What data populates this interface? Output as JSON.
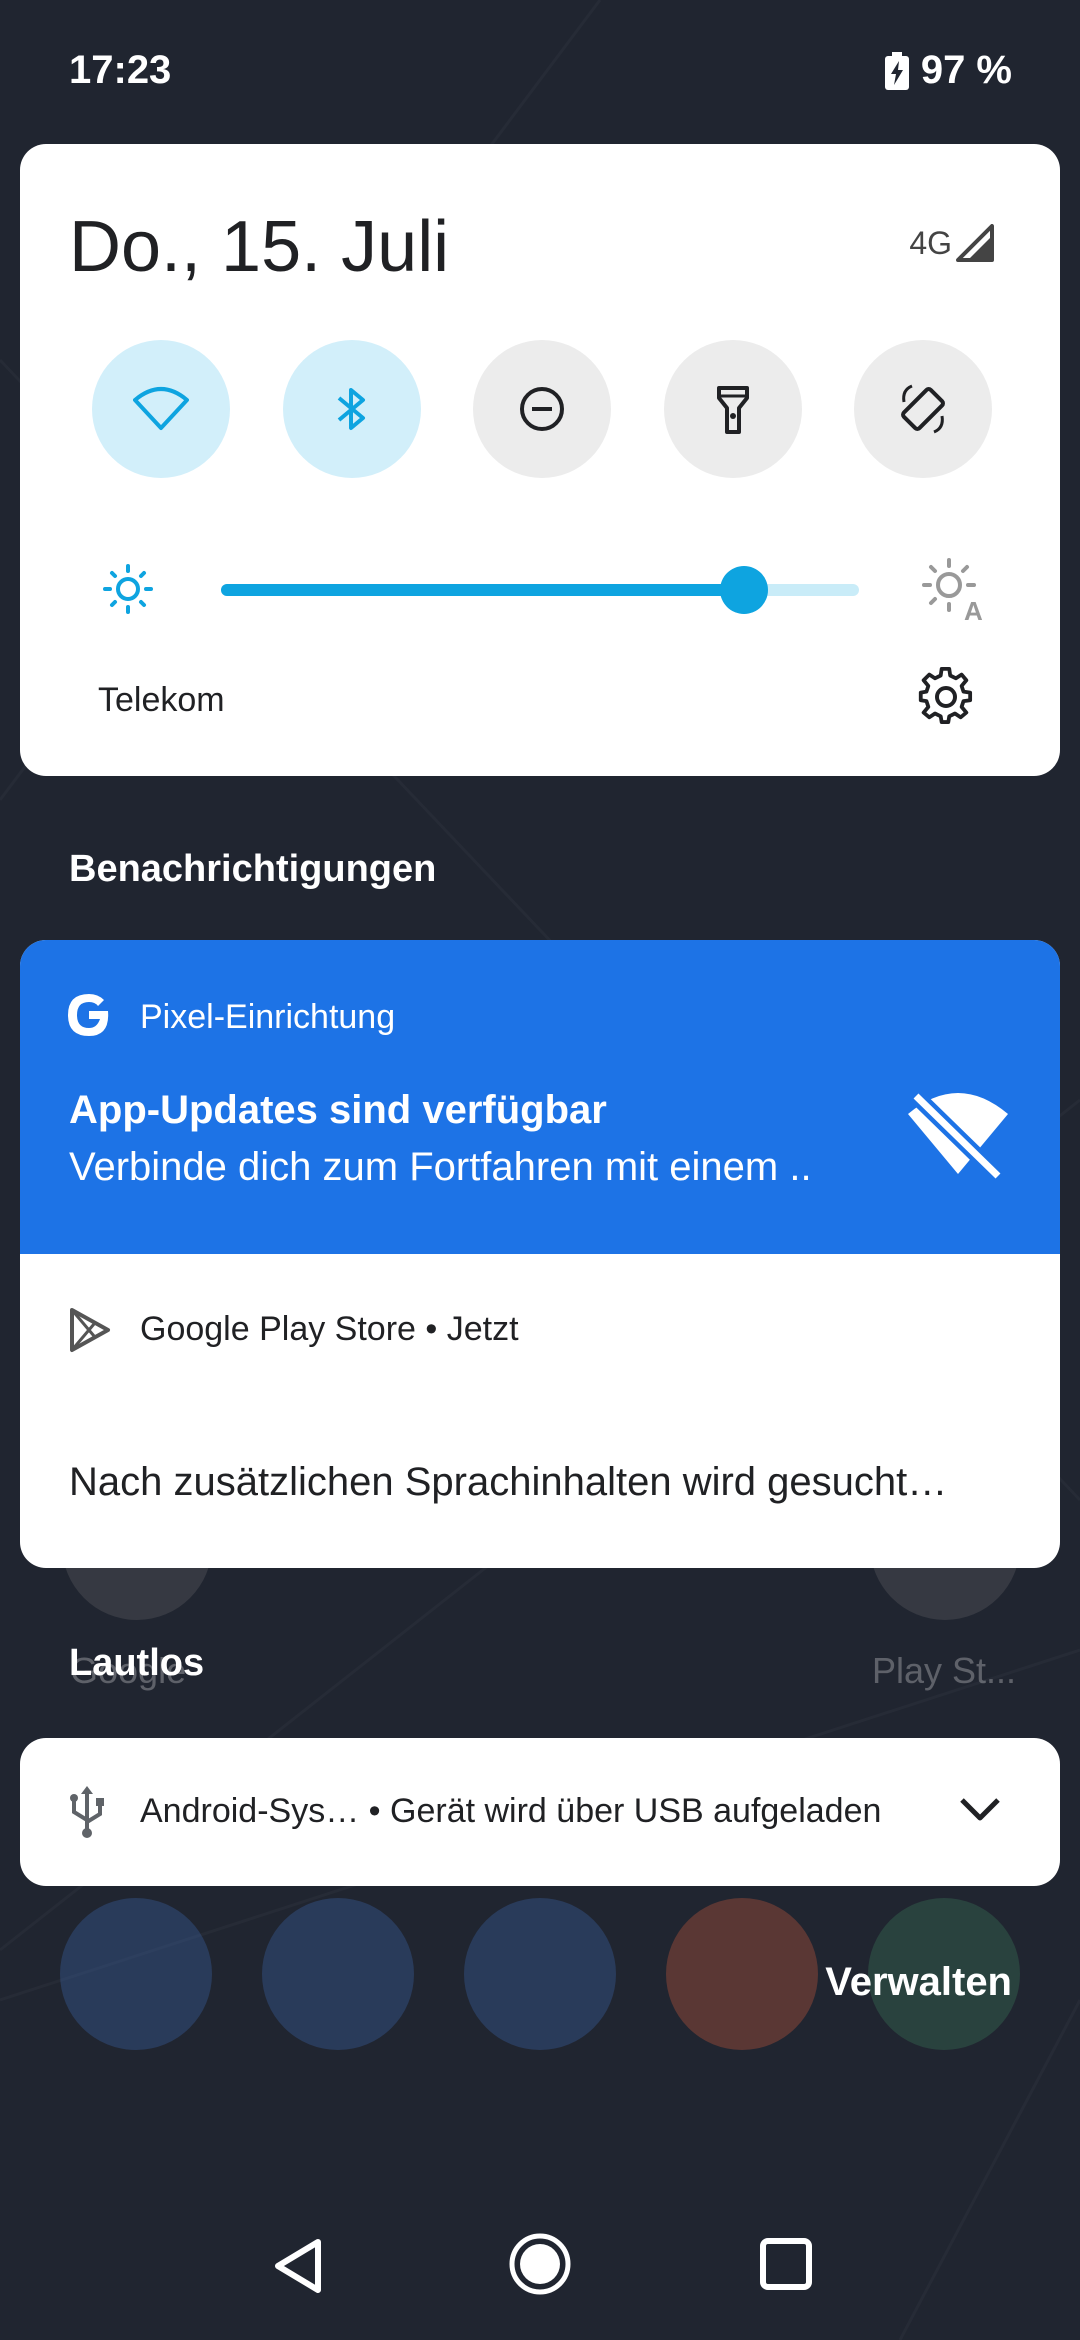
{
  "status_bar": {
    "time": "17:23",
    "battery": "97 %",
    "icons": [
      "battery-charging-icon"
    ]
  },
  "quick_settings": {
    "date": "Do., 15. Juli",
    "network_type": "4G",
    "tiles": [
      {
        "name": "wifi-icon",
        "state": "on"
      },
      {
        "name": "bluetooth-icon",
        "state": "on"
      },
      {
        "name": "do-not-disturb-icon",
        "state": "off"
      },
      {
        "name": "flashlight-icon",
        "state": "off"
      },
      {
        "name": "auto-rotate-icon",
        "state": "off"
      }
    ],
    "brightness": 0.82,
    "carrier": "Telekom",
    "colors": {
      "active_tile": "#d2effa",
      "accent": "#0ea4e0",
      "inactive_tile": "#ececec"
    }
  },
  "sections": {
    "notifications": "Benachrichtigungen",
    "silent": "Lautlos"
  },
  "notifications": {
    "setup": {
      "app": "Pixel-Einrichtung",
      "title": "App-Updates sind verfügbar",
      "text": "Verbinde dich zum Fortfahren mit einem ..",
      "color": "#1d73e6"
    },
    "play_store": {
      "app": "Google Play Store",
      "time": "Jetzt",
      "text": "Nach zusätzlichen Sprachinhalten wird gesucht…"
    },
    "android_system": {
      "app": "Android-Sys…",
      "text": "Gerät wird über USB aufgeladen"
    }
  },
  "home_labels": {
    "left": "Google",
    "right": "Play St..."
  },
  "manage_label": "Verwalten"
}
